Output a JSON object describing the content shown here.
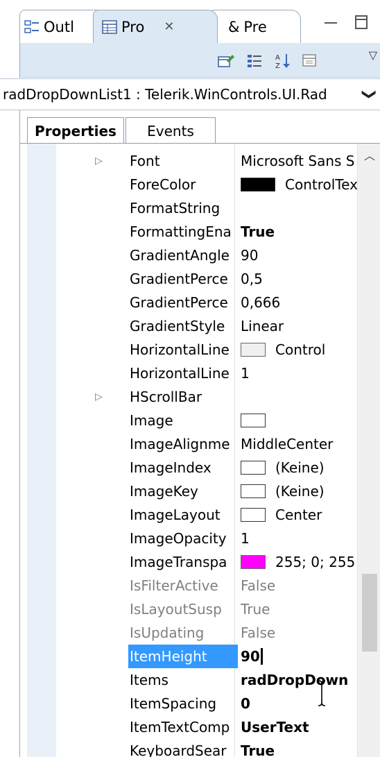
{
  "view_tabs": {
    "outline": "Outl",
    "properties": "Pro",
    "properties_close": "✕",
    "preview": "Pre",
    "preview_symbol": "&"
  },
  "selector": {
    "text": "radDropDownList1 : Telerik.WinControls.UI.Rad",
    "arrow": "❯"
  },
  "tabs": {
    "properties": "Properties",
    "events": "Events"
  },
  "properties": [
    {
      "name": "Font",
      "value": "Microsoft Sans S"
    },
    {
      "name": "ForeColor",
      "value": "ControlText",
      "swatch": "#000000"
    },
    {
      "name": "FormatString",
      "value": ""
    },
    {
      "name": "FormattingEna",
      "value": "True"
    },
    {
      "name": "GradientAngle",
      "value": "90"
    },
    {
      "name": "GradientPerce",
      "value": "0,5"
    },
    {
      "name": "GradientPerce",
      "value": "0,666"
    },
    {
      "name": "GradientStyle",
      "value": "Linear"
    },
    {
      "name": "HorizontalLine",
      "value": "Control",
      "swatch": "#f0f0f0"
    },
    {
      "name": "HorizontalLine",
      "value": "1"
    },
    {
      "name": "HScrollBar",
      "value": ""
    },
    {
      "name": "Image",
      "value": "",
      "swatch": "#ffffff"
    },
    {
      "name": "ImageAlignme",
      "value": "MiddleCenter"
    },
    {
      "name": "ImageIndex",
      "value": "(Keine)",
      "swatch": "#ffffff"
    },
    {
      "name": "ImageKey",
      "value": "(Keine)",
      "swatch": "#ffffff"
    },
    {
      "name": "ImageLayout",
      "value": "Center",
      "swatch": "#ffffff"
    },
    {
      "name": "ImageOpacity",
      "value": "1"
    },
    {
      "name": "ImageTranspa",
      "value": "255; 0; 255",
      "swatch": "#ff00ff"
    },
    {
      "name": "IsFilterActive",
      "value": "False"
    },
    {
      "name": "IsLayoutSusp",
      "value": "True"
    },
    {
      "name": "IsUpdating",
      "value": "False"
    },
    {
      "name": "ItemHeight",
      "value": "90"
    },
    {
      "name": "Items",
      "value": "radDropDown"
    },
    {
      "name": "ItemSpacing",
      "value": "0"
    },
    {
      "name": "ItemTextComp",
      "value": "UserText"
    },
    {
      "name": "KeyboardSear",
      "value": "True"
    }
  ],
  "colors": {
    "selection": "#3399ff",
    "toolbar": "#dde8f5",
    "readonly_text": "#808080"
  }
}
